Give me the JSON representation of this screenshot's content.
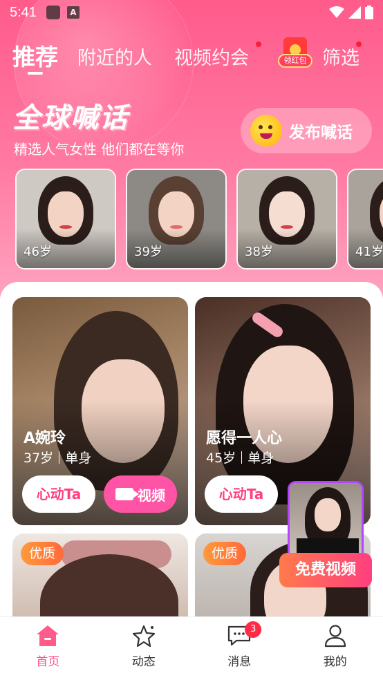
{
  "status_bar": {
    "time": "5:41"
  },
  "top_tabs": [
    {
      "label": "推荐",
      "active": true
    },
    {
      "label": "附近的人",
      "active": false
    },
    {
      "label": "视频约会",
      "active": false,
      "dot": true
    },
    {
      "label": "筛选",
      "active": false,
      "dot": true
    }
  ],
  "redpacket": {
    "label": "领红包"
  },
  "hero": {
    "headline": "全球喊话",
    "subline": "精选人气女性 他们都在等你",
    "publish_label": "发布喊话"
  },
  "strip": [
    {
      "age": "46岁"
    },
    {
      "age": "39岁"
    },
    {
      "age": "38岁"
    },
    {
      "age": "41岁"
    }
  ],
  "cards": [
    {
      "name": "A婉玲",
      "age": "37岁",
      "status": "单身",
      "like_label": "心动Ta",
      "video_label": "视频"
    },
    {
      "name": "愿得一人心",
      "age": "45岁",
      "status": "单身",
      "like_label": "心动Ta"
    }
  ],
  "lower_cards": [
    {
      "badge": "优质"
    },
    {
      "badge": "优质"
    }
  ],
  "float_video": {
    "label": "免费视频"
  },
  "bottom_nav": [
    {
      "label": "首页",
      "icon": "home-icon",
      "active": true
    },
    {
      "label": "动态",
      "icon": "star-icon",
      "active": false
    },
    {
      "label": "消息",
      "icon": "chat-icon",
      "active": false,
      "badge": "3"
    },
    {
      "label": "我的",
      "icon": "user-icon",
      "active": false
    }
  ],
  "colors": {
    "brand_pink": "#ff5b8b",
    "accent": "#ff3f7f",
    "badge_red": "#ff2b47",
    "premium_orange": "#ff8a3c"
  }
}
